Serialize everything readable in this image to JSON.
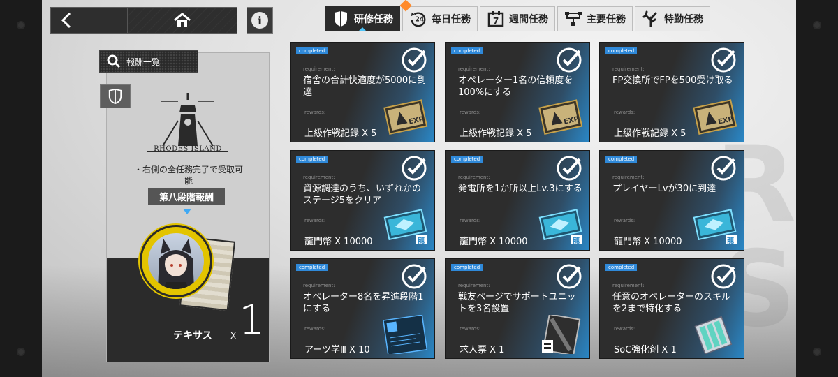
{
  "colors": {
    "accent_blue": "#2f89d9",
    "completed_badge": "#2f89d9",
    "avatar_ring": "#e3c400",
    "tab_active_bg": "#2b2b2b",
    "tab_bg": "#e9e9e9",
    "notification_badge": "#ff8a2a"
  },
  "nav": {
    "back_icon": "chevron-left-icon",
    "home_icon": "home-icon",
    "info_label": "i"
  },
  "tabs": [
    {
      "label": "研修任務",
      "icon": "shield-icon",
      "active": true
    },
    {
      "label": "毎日任務",
      "icon": "24h-cycle-icon",
      "active": false
    },
    {
      "label": "週間任務",
      "icon": "calendar-7-icon",
      "active": false
    },
    {
      "label": "主要任務",
      "icon": "org-chart-icon",
      "active": false
    },
    {
      "label": "特勤任務",
      "icon": "tree-icon",
      "active": false
    }
  ],
  "left_panel": {
    "search_label": "報酬一覧",
    "logo_text": "RHODES ISLAND",
    "note": "・右側の全任務完了で受取可能",
    "stage_label": "第八段階報酬",
    "item_name": "テキサス",
    "item_x": "X",
    "item_count": "1"
  },
  "cards_common": {
    "status": "completed",
    "requirement_label": "requirement:",
    "rewards_label": "rewards:"
  },
  "cards": [
    {
      "description": "宿舎の合計快適度が5000に到達",
      "reward": "上級作戦記録 X 5",
      "thumb": "exp-card-icon"
    },
    {
      "description": "オペレーター1名の信頼度を100%にする",
      "reward": "上級作戦記録 X 5",
      "thumb": "exp-card-icon"
    },
    {
      "description": "FP交換所でFPを500受け取る",
      "reward": "上級作戦記録 X 5",
      "thumb": "exp-card-icon"
    },
    {
      "description": "資源調達のうち、いずれかのステージ5をクリア",
      "reward": "龍門幣 X 10000",
      "thumb": "lmd-icon"
    },
    {
      "description": "発電所を1か所以上Lv.3にする",
      "reward": "龍門幣 X 10000",
      "thumb": "lmd-icon"
    },
    {
      "description": "プレイヤーLvが30に到達",
      "reward": "龍門幣 X 10000",
      "thumb": "lmd-icon"
    },
    {
      "description": "オペレーター8名を昇進段階1にする",
      "reward": "アーツ学Ⅲ X 10",
      "thumb": "skill-book-icon"
    },
    {
      "description": "戦友ページでサポートユニットを3名設置",
      "reward": "求人票 X 1",
      "thumb": "recruit-permit-icon"
    },
    {
      "description": "任意のオペレーターのスキルを2まで特化する",
      "reward": "SoC強化剤 X 1",
      "thumb": "soc-vial-icon"
    }
  ]
}
